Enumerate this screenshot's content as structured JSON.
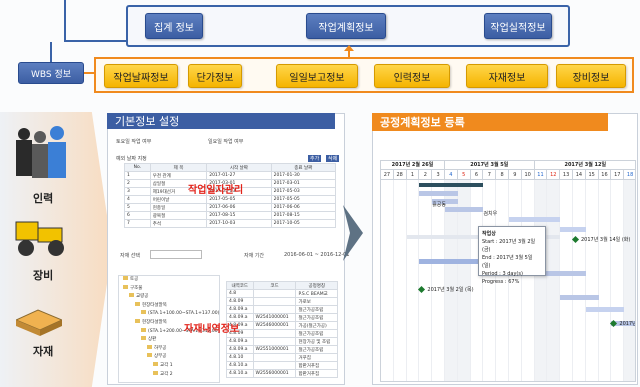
{
  "top": {
    "info_buttons": [
      "집계 정보",
      "작업계획정보",
      "작업실적정보"
    ],
    "wbs_label": "WBS 정보",
    "categories": [
      "작업날짜정보",
      "단가정보",
      "일일보고정보",
      "인력정보",
      "자재정보",
      "장비정보"
    ]
  },
  "resources": [
    "인력",
    "장비",
    "자재"
  ],
  "left_panel": {
    "title": "기본정보 설정",
    "overlay_top": "작업일자관리",
    "overlay_bottom": "자재내역정보",
    "check_a": "토요일 작업 여부",
    "check_b": "일요일 작업 여부",
    "holiday_title": "예외 날짜 지정",
    "add_btn": "추가",
    "del_btn": "삭제",
    "holiday_headers": [
      "No.",
      "제 목",
      "시작 날짜",
      "종료 날짜"
    ],
    "holiday_rows": [
      [
        "1",
        "우천 관계",
        "2017-01-27",
        "2017-01-30"
      ],
      [
        "2",
        "삼일절",
        "2017-03-01",
        "2017-03-01"
      ],
      [
        "3",
        "제19대선거",
        "2017-05-03",
        "2017-05-03"
      ],
      [
        "4",
        "어린이날",
        "2017-05-05",
        "2017-05-05"
      ],
      [
        "5",
        "현충일",
        "2017-06-06",
        "2017-06-06"
      ],
      [
        "6",
        "광복절",
        "2017-08-15",
        "2017-08-15"
      ],
      [
        "7",
        "추석",
        "2017-10-03",
        "2017-10-05"
      ]
    ],
    "material_label": "자재 선택",
    "period_label": "자재 기간",
    "period_value": "2016-06-01 ~ 2016-12-01",
    "tree": [
      "토공",
      "구조물",
      "교량공",
      "현장타설말뚝",
      "(STA.1+100.00~STA.1+137.00)",
      "현장타설말뚝",
      "(STA.1+200.00~STA.1+317.00)",
      "상판",
      "하부공",
      "상부공",
      "교각 1",
      "교각 2"
    ],
    "mat_headers": [
      "내역코드",
      "코드",
      "공정명칭"
    ],
    "mat_rows": [
      [
        "4.8",
        "",
        "P.S.C BEAM교"
      ],
      [
        "4.8.09",
        "",
        "가로보"
      ],
      [
        "4.8.09.a",
        "",
        "철근가공조립"
      ],
      [
        "4.8.09.a",
        "W2541000001",
        "철근가공조립"
      ],
      [
        "4.8.09.a",
        "W2546000001",
        "가공(철근가공)"
      ],
      [
        "4.8.09",
        "",
        "철근가공조립"
      ],
      [
        "4.8.09.a",
        "",
        "현장가공 및 조립"
      ],
      [
        "4.8.09.a",
        "W2551000001",
        "철근가공조립"
      ],
      [
        "4.8.10",
        "",
        "거푸집"
      ],
      [
        "4.8.10.a",
        "",
        "합판거푸집"
      ],
      [
        "4.8.10.a",
        "W2556000001",
        "합판거푸집"
      ]
    ]
  },
  "right_panel": {
    "title": "공정계획정보 등록",
    "weeks": [
      "2017년 2월 26일",
      "2017년 3월 5일",
      "2017년 3월 12일"
    ],
    "days": [
      "27",
      "28",
      "1",
      "2",
      "3",
      "4",
      "5",
      "6",
      "7",
      "8",
      "9",
      "10",
      "11",
      "12",
      "13",
      "14",
      "15",
      "16",
      "17",
      "18"
    ],
    "task_labels": [
      "흙공동",
      "검치우"
    ],
    "milestones": [
      "2017년 3월 14일 (화)",
      "2017년 3월 2일 (목)",
      "2017년 3"
    ],
    "tooltip": [
      "작업상",
      "Start : 2017년 3월 2일 (금)",
      "End : 2017년 3월 5일 (일)",
      "Period : 3 day(s)",
      "Progress : 67%"
    ]
  }
}
